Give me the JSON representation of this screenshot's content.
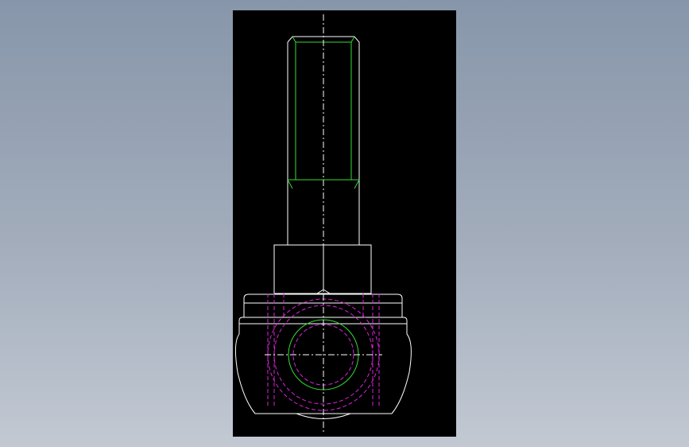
{
  "viewer": {
    "background": "#000000",
    "colors": {
      "outline": "#ffffff",
      "thread": "#33dd33",
      "hidden": "#dd22dd",
      "centerline": "#ffffff"
    }
  }
}
